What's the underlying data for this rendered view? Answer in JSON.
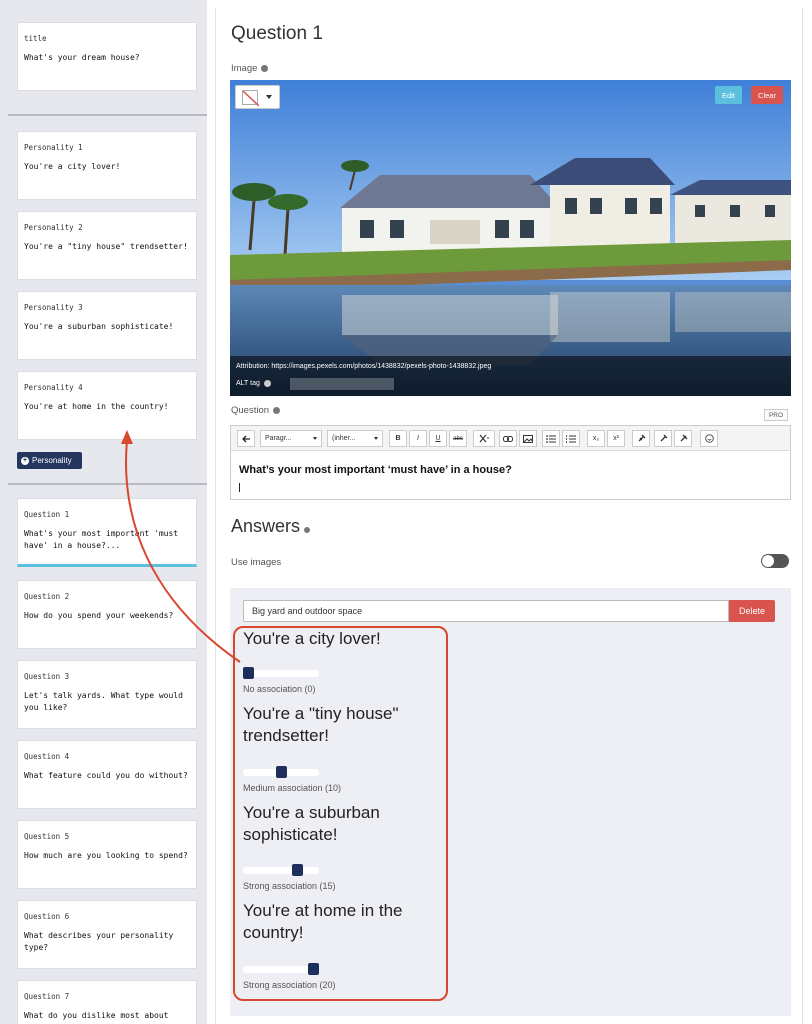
{
  "sidebar": {
    "title_card": {
      "label": "title",
      "text": "What's your dream house?"
    },
    "personalities": [
      {
        "label": "Personality 1",
        "text": "You're a city lover!"
      },
      {
        "label": "Personality 2",
        "text": "You're a \"tiny house\" trendsetter!"
      },
      {
        "label": "Personality 3",
        "text": "You're a suburban sophisticate!"
      },
      {
        "label": "Personality 4",
        "text": "You're at home in the country!"
      }
    ],
    "add_personality_label": "Personality",
    "questions": [
      {
        "label": "Question 1",
        "text": "What's your most important 'must have' in a house?..."
      },
      {
        "label": "Question 2",
        "text": "How do you spend your weekends?"
      },
      {
        "label": "Question 3",
        "text": "Let's talk yards. What type would you like?"
      },
      {
        "label": "Question 4",
        "text": "What feature could you do without?"
      },
      {
        "label": "Question 5",
        "text": "How much are you looking to spend?"
      },
      {
        "label": "Question 6",
        "text": "What describes your personality type?"
      },
      {
        "label": "Question 7",
        "text": "What do you dislike most about"
      }
    ]
  },
  "main": {
    "title": "Question 1",
    "image_label": "Image",
    "edit_label": "Edit",
    "clear_label": "Clear",
    "attribution": "Attribution: https://images.pexels.com/photos/1438832/pexels-photo-1438832.jpeg",
    "alt_label": "ALT tag",
    "question_label": "Question",
    "pro_badge": "PRO",
    "toolbar": {
      "paragraph": "Paragr...",
      "inherit": "(inher...",
      "bold": "B",
      "italic": "I",
      "underline": "U",
      "strike": "abc",
      "sub": "x₂",
      "sup": "x²"
    },
    "question_text": "What’s your most important ‘must have’ in a house?",
    "answers_title": "Answers",
    "use_images_label": "Use images",
    "answer_value": "Big yard and outdoor space",
    "delete_label": "Delete",
    "associations": [
      {
        "personality": "You're a city lover!",
        "level_text": "No association (0)",
        "value": 0
      },
      {
        "personality": "You're a \"tiny house\" trendsetter!",
        "level_text": "Medium association (10)",
        "value": 10
      },
      {
        "personality": "You're a suburban sophisticate!",
        "level_text": "Strong association (15)",
        "value": 15
      },
      {
        "personality": "You're at home in the country!",
        "level_text": "Strong association (20)",
        "value": 20
      }
    ],
    "association_max": 20
  },
  "colors": {
    "navy": "#1c2f5e",
    "info": "#5bc0de",
    "danger": "#d9534f",
    "annotation": "#d9472f"
  }
}
